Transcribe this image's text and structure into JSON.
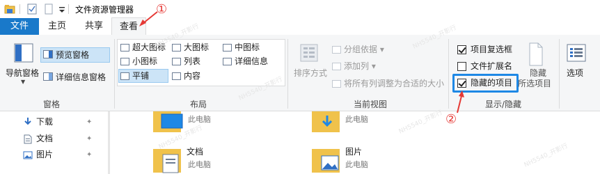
{
  "window": {
    "title": "文件资源管理器"
  },
  "quick_access": {
    "icons": [
      "folder-icon",
      "properties-icon",
      "new-folder-icon",
      "dropdown-arrow-icon"
    ]
  },
  "tabs": {
    "file": "文件",
    "home": "主页",
    "share": "共享",
    "view": "查看"
  },
  "annotations": {
    "one": "①",
    "two": "②"
  },
  "ribbon": {
    "panes": {
      "label": "窗格",
      "nav_pane": "导航窗格",
      "preview_pane": "预览窗格",
      "details_pane": "详细信息窗格"
    },
    "layout": {
      "label": "布局",
      "extra_large_icons": "超大图标",
      "large_icons": "大图标",
      "medium_icons": "中图标",
      "small_icons": "小图标",
      "list": "列表",
      "details": "详细信息",
      "tiles": "平铺",
      "content": "内容"
    },
    "current_view": {
      "label": "当前视图",
      "sort_by": "排序方式",
      "group_by": "分组依据",
      "add_columns": "添加列",
      "size_all_columns": "将所有列调整为合适的大小"
    },
    "show_hide": {
      "label": "显示/隐藏",
      "item_checkboxes": "项目复选框",
      "item_checkboxes_checked": true,
      "file_extensions": "文件扩展名",
      "file_extensions_checked": false,
      "hidden_items": "隐藏的项目",
      "hidden_items_checked": true,
      "hide_selected": "隐藏",
      "hide_selected_line2": "所选项目"
    },
    "options": {
      "label": "选项"
    }
  },
  "nav": {
    "items": [
      {
        "label": "下载",
        "icon": "download-icon"
      },
      {
        "label": "文档",
        "icon": "document-icon"
      },
      {
        "label": "图片",
        "icon": "picture-icon"
      }
    ]
  },
  "content": {
    "folders": [
      {
        "name": "",
        "location": "此电脑",
        "icon": "desktop-folder-icon"
      },
      {
        "name": "",
        "location": "此电脑",
        "icon": "downloads-folder-icon"
      },
      {
        "name": "文档",
        "location": "此电脑",
        "icon": "documents-folder-icon"
      },
      {
        "name": "图片",
        "location": "此电脑",
        "icon": "pictures-folder-icon"
      }
    ]
  },
  "colors": {
    "accent": "#1979ca",
    "annotation": "#e53935",
    "highlight": "#1e88e5"
  },
  "watermark": "NH5540_开影行"
}
